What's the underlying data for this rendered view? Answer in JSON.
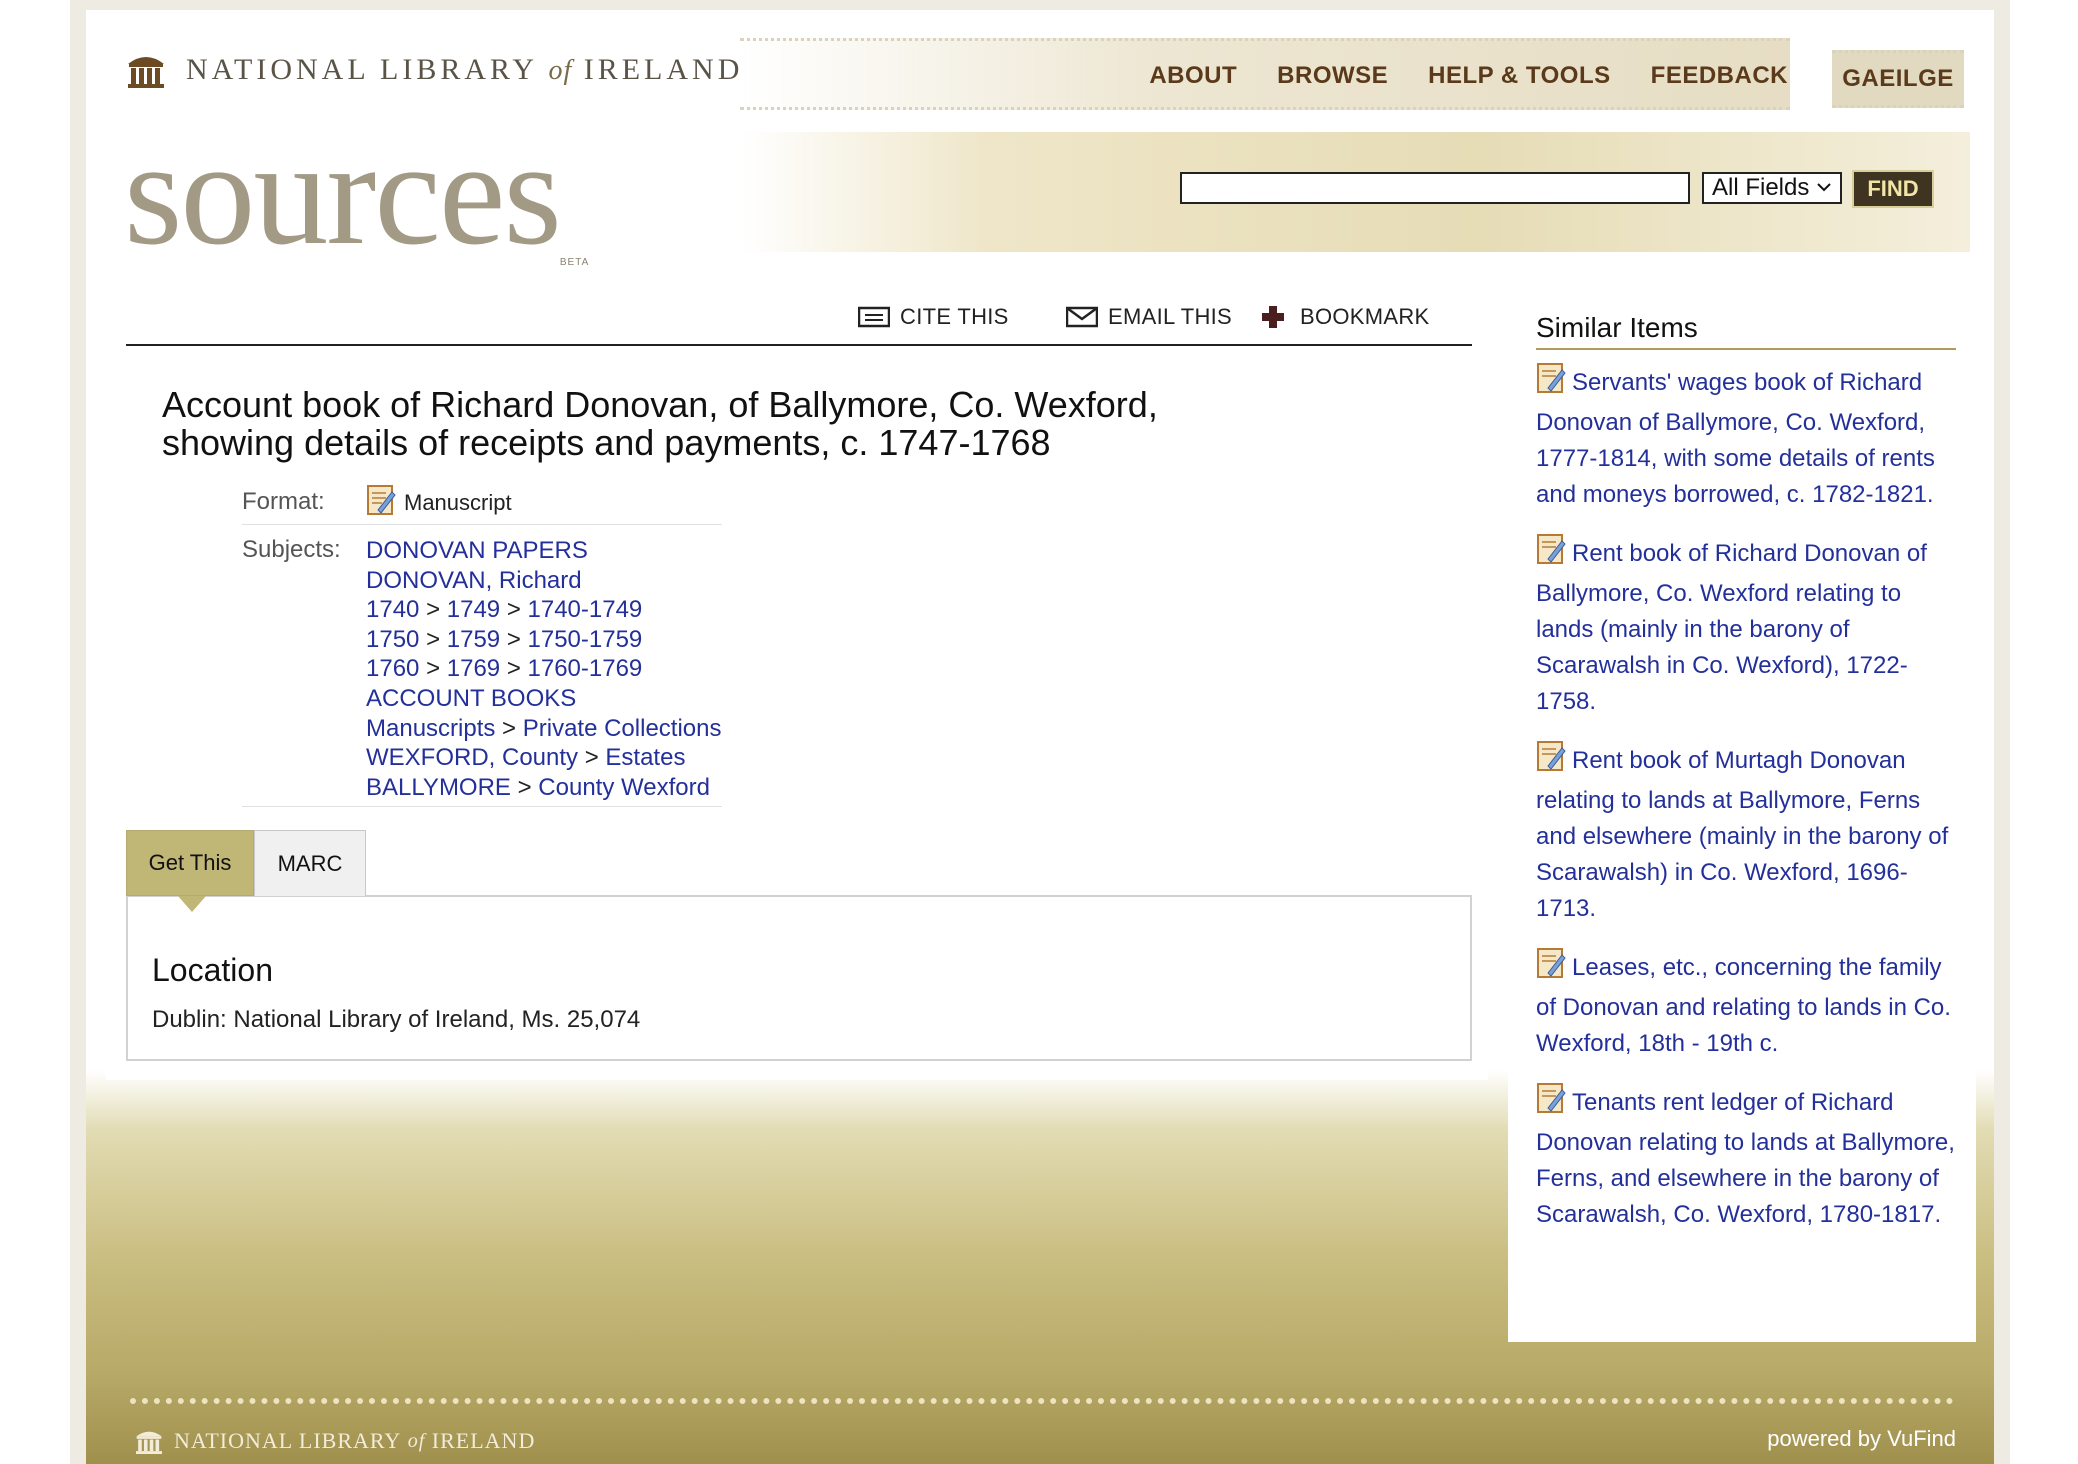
{
  "header": {
    "library_name_1": "NATIONAL LIBRARY",
    "library_name_of": "of",
    "library_name_2": "IRELAND",
    "site_title": "sources",
    "site_badge": "BETA",
    "nav": [
      "ABOUT",
      "BROWSE",
      "HELP & TOOLS",
      "FEEDBACK"
    ],
    "language_link": "GAEILGE",
    "search": {
      "value": "",
      "scope": "All Fields",
      "find_label": "FIND"
    }
  },
  "toolbar": {
    "cite": "CITE THIS",
    "email": "EMAIL THIS",
    "bookmark": "BOOKMARK"
  },
  "record": {
    "title_line1": "Account book of Richard Donovan, of Ballymore, Co. Wexford,",
    "title_line2": "showing details of receipts and payments, c. 1747-1768",
    "format_label": "Format:",
    "format_value": "Manuscript",
    "subjects_label": "Subjects:",
    "subjects": [
      [
        "DONOVAN PAPERS"
      ],
      [
        "DONOVAN, Richard"
      ],
      [
        "1740",
        "1749",
        "1740-1749"
      ],
      [
        "1750",
        "1759",
        "1750-1759"
      ],
      [
        "1760",
        "1769",
        "1760-1769"
      ],
      [
        "ACCOUNT BOOKS"
      ],
      [
        "Manuscripts",
        "Private Collections"
      ],
      [
        "WEXFORD, County",
        "Estates"
      ],
      [
        "BALLYMORE",
        "County Wexford"
      ]
    ],
    "subject_separator": ">"
  },
  "tabs": {
    "get_this": "Get This",
    "marc": "MARC",
    "location_heading": "Location",
    "location_text": "Dublin: National Library of Ireland, Ms. 25,074"
  },
  "similar": {
    "title": "Similar Items",
    "items": [
      "Servants' wages book of Richard Donovan of Ballymore, Co. Wexford, 1777-1814, with some details of rents and moneys borrowed, c. 1782-1821.",
      "Rent book of Richard Donovan of Ballymore, Co. Wexford relating to lands (mainly in the barony of Scarawalsh in Co. Wexford), 1722-1758.",
      "Rent book of Murtagh Donovan relating to lands at Ballymore, Ferns and elsewhere (mainly in the barony of Scarawalsh) in Co. Wexford, 1696-1713.",
      "Leases, etc., concerning the family of Donovan and relating to lands in Co. Wexford, 18th - 19th c.",
      "Tenants rent ledger of Richard Donovan relating to lands at Ballymore, Ferns, and elsewhere in the barony of Scarawalsh, Co. Wexford, 1780-1817."
    ]
  },
  "footer": {
    "library_1": "NATIONAL LIBRARY",
    "library_of": "of",
    "library_2": "IRELAND",
    "powered_prefix": "powered by",
    "powered_name": "VuFind"
  },
  "colors": {
    "link": "#24309a",
    "nav": "#5a3a1a",
    "accent_gold": "#c0b676",
    "find_bg": "#3f3321"
  }
}
